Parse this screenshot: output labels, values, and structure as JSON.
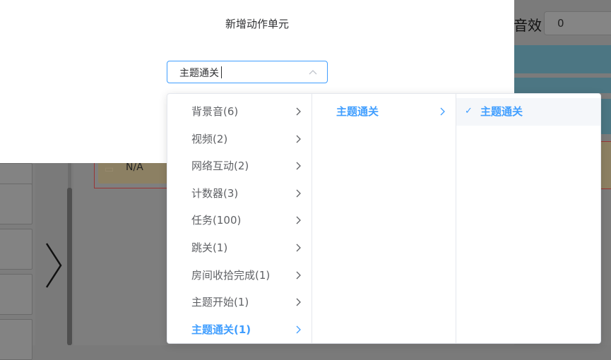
{
  "background": {
    "label": "音效",
    "input_value": "0",
    "card_text": "N/A",
    "teal_color": "#4c7683"
  },
  "dialog": {
    "title": "新增动作单元",
    "cascader_value": "主题通关",
    "accent_color": "#409eff"
  },
  "cascader": {
    "column1": [
      {
        "label": "背景音(6)",
        "active": false
      },
      {
        "label": "视频(2)",
        "active": false
      },
      {
        "label": "网络互动(2)",
        "active": false
      },
      {
        "label": "计数器(3)",
        "active": false
      },
      {
        "label": "任务(100)",
        "active": false
      },
      {
        "label": "跳关(1)",
        "active": false
      },
      {
        "label": "房间收拾完成(1)",
        "active": false
      },
      {
        "label": "主题开始(1)",
        "active": false
      },
      {
        "label": "主题通关(1)",
        "active": true
      }
    ],
    "column2": [
      {
        "label": "主题通关",
        "active": true
      }
    ],
    "column3": [
      {
        "label": "主题通关",
        "selected": true,
        "check_icon": "check-icon"
      }
    ]
  }
}
